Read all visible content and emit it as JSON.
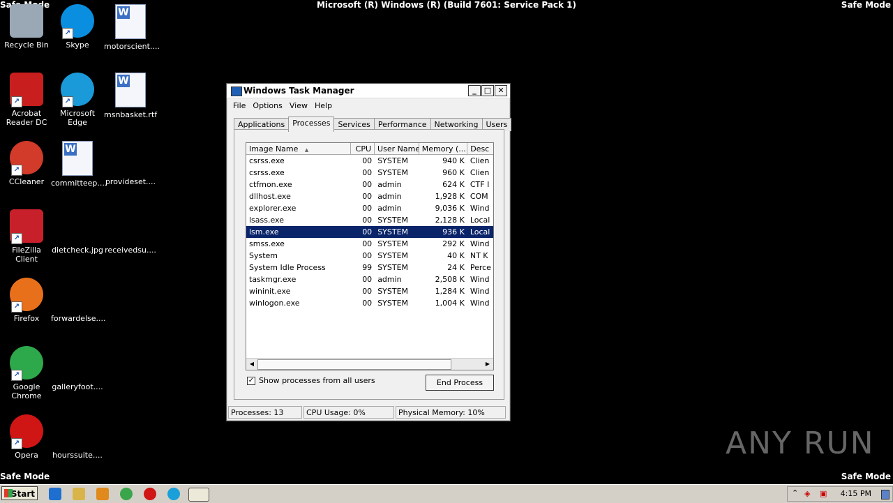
{
  "screen": {
    "safe_mode": "Safe Mode",
    "build_text": "Microsoft (R) Windows (R) (Build 7601: Service Pack 1)"
  },
  "desktop_icons": [
    {
      "label": "Recycle Bin",
      "icon": "recycle-bin-icon"
    },
    {
      "label": "Skype",
      "icon": "skype-icon"
    },
    {
      "label": "motorscient....",
      "icon": "word-document-icon"
    },
    {
      "label": "Acrobat Reader DC",
      "icon": "acrobat-icon"
    },
    {
      "label": "Microsoft Edge",
      "icon": "edge-icon"
    },
    {
      "label": "msnbasket.rtf",
      "icon": "word-document-icon"
    },
    {
      "label": "CCleaner",
      "icon": "ccleaner-icon"
    },
    {
      "label": "committeep....",
      "icon": "word-document-icon"
    },
    {
      "label": "provideset....",
      "icon": "blank-file-icon"
    },
    {
      "label": "FileZilla Client",
      "icon": "filezilla-icon"
    },
    {
      "label": "dietcheck.jpg",
      "icon": "blank-file-icon"
    },
    {
      "label": "receivedsu....",
      "icon": "blank-file-icon"
    },
    {
      "label": "Firefox",
      "icon": "firefox-icon"
    },
    {
      "label": "forwardelse....",
      "icon": "blank-file-icon"
    },
    {
      "label": "Google Chrome",
      "icon": "chrome-icon"
    },
    {
      "label": "galleryfoot....",
      "icon": "blank-file-icon"
    },
    {
      "label": "Opera",
      "icon": "opera-icon"
    },
    {
      "label": "hourssuite....",
      "icon": "blank-file-icon"
    }
  ],
  "window": {
    "title": "Windows Task Manager",
    "controls": {
      "minimize": "_",
      "maximize": "□",
      "close": "✕"
    },
    "menu": [
      "File",
      "Options",
      "View",
      "Help"
    ],
    "tabs": [
      "Applications",
      "Processes",
      "Services",
      "Performance",
      "Networking",
      "Users"
    ],
    "active_tab": "Processes",
    "columns": [
      "Image Name",
      "CPU",
      "User Name",
      "Memory (...",
      "Desc"
    ],
    "processes": [
      {
        "name": "csrss.exe",
        "cpu": "00",
        "user": "SYSTEM",
        "mem": "940 K",
        "desc": "Clien"
      },
      {
        "name": "csrss.exe",
        "cpu": "00",
        "user": "SYSTEM",
        "mem": "960 K",
        "desc": "Clien"
      },
      {
        "name": "ctfmon.exe",
        "cpu": "00",
        "user": "admin",
        "mem": "624 K",
        "desc": "CTF I"
      },
      {
        "name": "dllhost.exe",
        "cpu": "00",
        "user": "admin",
        "mem": "1,928 K",
        "desc": "COM"
      },
      {
        "name": "explorer.exe",
        "cpu": "00",
        "user": "admin",
        "mem": "9,036 K",
        "desc": "Wind"
      },
      {
        "name": "lsass.exe",
        "cpu": "00",
        "user": "SYSTEM",
        "mem": "2,128 K",
        "desc": "Local"
      },
      {
        "name": "lsm.exe",
        "cpu": "00",
        "user": "SYSTEM",
        "mem": "936 K",
        "desc": "Local"
      },
      {
        "name": "smss.exe",
        "cpu": "00",
        "user": "SYSTEM",
        "mem": "292 K",
        "desc": "Wind"
      },
      {
        "name": "System",
        "cpu": "00",
        "user": "SYSTEM",
        "mem": "40 K",
        "desc": "NT K"
      },
      {
        "name": "System Idle Process",
        "cpu": "99",
        "user": "SYSTEM",
        "mem": "24 K",
        "desc": "Perce"
      },
      {
        "name": "taskmgr.exe",
        "cpu": "00",
        "user": "admin",
        "mem": "2,508 K",
        "desc": "Wind"
      },
      {
        "name": "wininit.exe",
        "cpu": "00",
        "user": "SYSTEM",
        "mem": "1,284 K",
        "desc": "Wind"
      },
      {
        "name": "winlogon.exe",
        "cpu": "00",
        "user": "SYSTEM",
        "mem": "1,004 K",
        "desc": "Wind"
      }
    ],
    "selected_row": 6,
    "show_all_label": "Show processes from all users",
    "show_all_checked": true,
    "end_process_label": "End Process",
    "status": {
      "processes": "Processes: 13",
      "cpu": "CPU Usage: 0%",
      "memory": "Physical Memory: 10%"
    }
  },
  "taskbar": {
    "start_label": "Start",
    "clock": "4:15 PM"
  },
  "watermark": "ANY RUN"
}
